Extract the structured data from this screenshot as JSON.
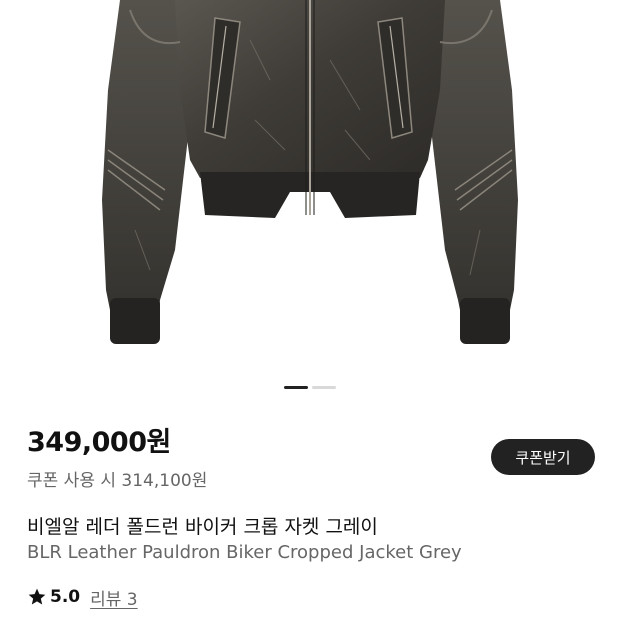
{
  "product": {
    "image_alt": "jacket-photo",
    "price": "349,000원",
    "coupon_price": "쿠폰 사용 시 314,100원",
    "coupon_button_label": "쿠폰받기",
    "title_ko": "비엘알 레더 폴드런 바이커 크롭 자켓 그레이",
    "title_en": "BLR Leather Pauldron Biker Cropped Jacket Grey",
    "rating": "5.0",
    "review_link": "리뷰 3"
  },
  "carousel": {
    "current_index": 1,
    "total": 2
  },
  "colors": {
    "accent_button": "#222222",
    "secondary_text": "#666666"
  },
  "icons": {
    "rating": "star-icon"
  }
}
